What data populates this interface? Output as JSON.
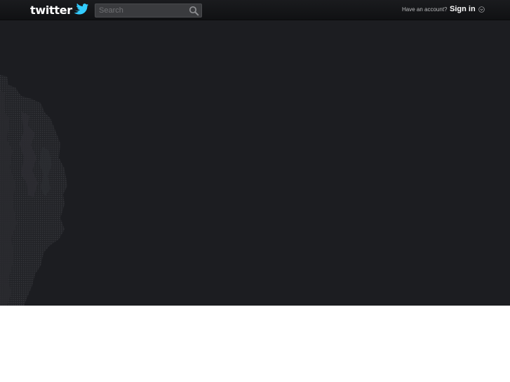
{
  "header": {
    "logo_text": "twitter",
    "search": {
      "placeholder": "Search",
      "value": ""
    },
    "have_account_text": "Have an account?",
    "signin_label": "Sign in"
  },
  "icons": {
    "logo_bird": "twitter-bird-icon",
    "search": "search-icon",
    "signin_menu": "chevron-down-circle-icon"
  },
  "colors": {
    "topbar_background": "#141518",
    "stage_background": "#1c1d21",
    "page_background": "#ffffff",
    "texture": "#2b2c30"
  }
}
